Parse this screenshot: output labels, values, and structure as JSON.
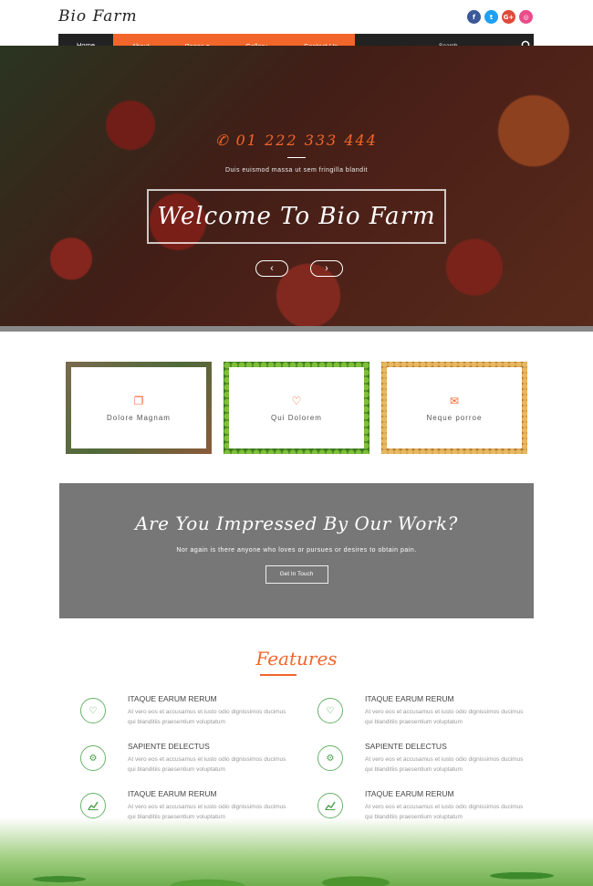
{
  "header": {
    "logo": "Bio Farm",
    "socials": [
      {
        "name": "facebook-icon",
        "glyph": "f",
        "color": "#3b5998"
      },
      {
        "name": "twitter-icon",
        "glyph": "t",
        "color": "#1da1f2"
      },
      {
        "name": "google-plus-icon",
        "glyph": "G+",
        "color": "#dd4b39"
      },
      {
        "name": "dribbble-icon",
        "glyph": "◎",
        "color": "#ea4c89"
      }
    ]
  },
  "nav": {
    "items": [
      "Home",
      "About",
      "Pages ▾",
      "Gallery",
      "Contact Us"
    ],
    "active": "Home",
    "search_placeholder": "Search..."
  },
  "hero": {
    "phone": "01 222 333 444",
    "subtitle": "Duis euismod massa ut sem fringilla blandit",
    "title": "Welcome To Bio Farm",
    "prev": "‹",
    "next": "›"
  },
  "services": [
    {
      "label": "Dolore Magnam",
      "icon": "copy-icon",
      "glyph": "❐"
    },
    {
      "label": "Qui Dolorem",
      "icon": "heart-icon",
      "glyph": "♡"
    },
    {
      "label": "Neque porroe",
      "icon": "envelope-icon",
      "glyph": "✉"
    }
  ],
  "callout": {
    "title": "Are You Impressed By Our Work?",
    "text": "Nor again is there anyone who loves or pursues or desires to obtain pain.",
    "button": "Get In Touch"
  },
  "features": {
    "title": "Features",
    "items": [
      {
        "heading": "ITAQUE EARUM RERUM",
        "text": "At vero eos et accusamus et iusto odio dignissimos ducimus qui blanditiis praesentium voluptatum",
        "icon": "heart-icon",
        "glyph": "♡"
      },
      {
        "heading": "ITAQUE EARUM RERUM",
        "text": "At vero eos et accusamus et iusto odio dignissimos ducimus qui blanditiis praesentium voluptatum",
        "icon": "heart-icon",
        "glyph": "♡"
      },
      {
        "heading": "SAPIENTE DELECTUS",
        "text": "At vero eos et accusamus et iusto odio dignissimos ducimus qui blanditiis praesentium voluptatum",
        "icon": "gears-icon",
        "glyph": "⚙"
      },
      {
        "heading": "SAPIENTE DELECTUS",
        "text": "At vero eos et accusamus et iusto odio dignissimos ducimus qui blanditiis praesentium voluptatum",
        "icon": "gears-icon",
        "glyph": "⚙"
      },
      {
        "heading": "ITAQUE EARUM RERUM",
        "text": "At vero eos et accusamus et iusto odio dignissimos ducimus qui blanditiis praesentium voluptatum",
        "icon": "line-chart-icon",
        "glyph": "📈"
      },
      {
        "heading": "ITAQUE EARUM RERUM",
        "text": "At vero eos et accusamus et iusto odio dignissimos ducimus qui blanditiis praesentium voluptatum",
        "icon": "line-chart-icon",
        "glyph": "📈"
      }
    ]
  },
  "colors": {
    "accent": "#f2662b",
    "nav_dark": "#222222",
    "callout_bg": "#777777",
    "feature_green": "#4a9e4a"
  }
}
